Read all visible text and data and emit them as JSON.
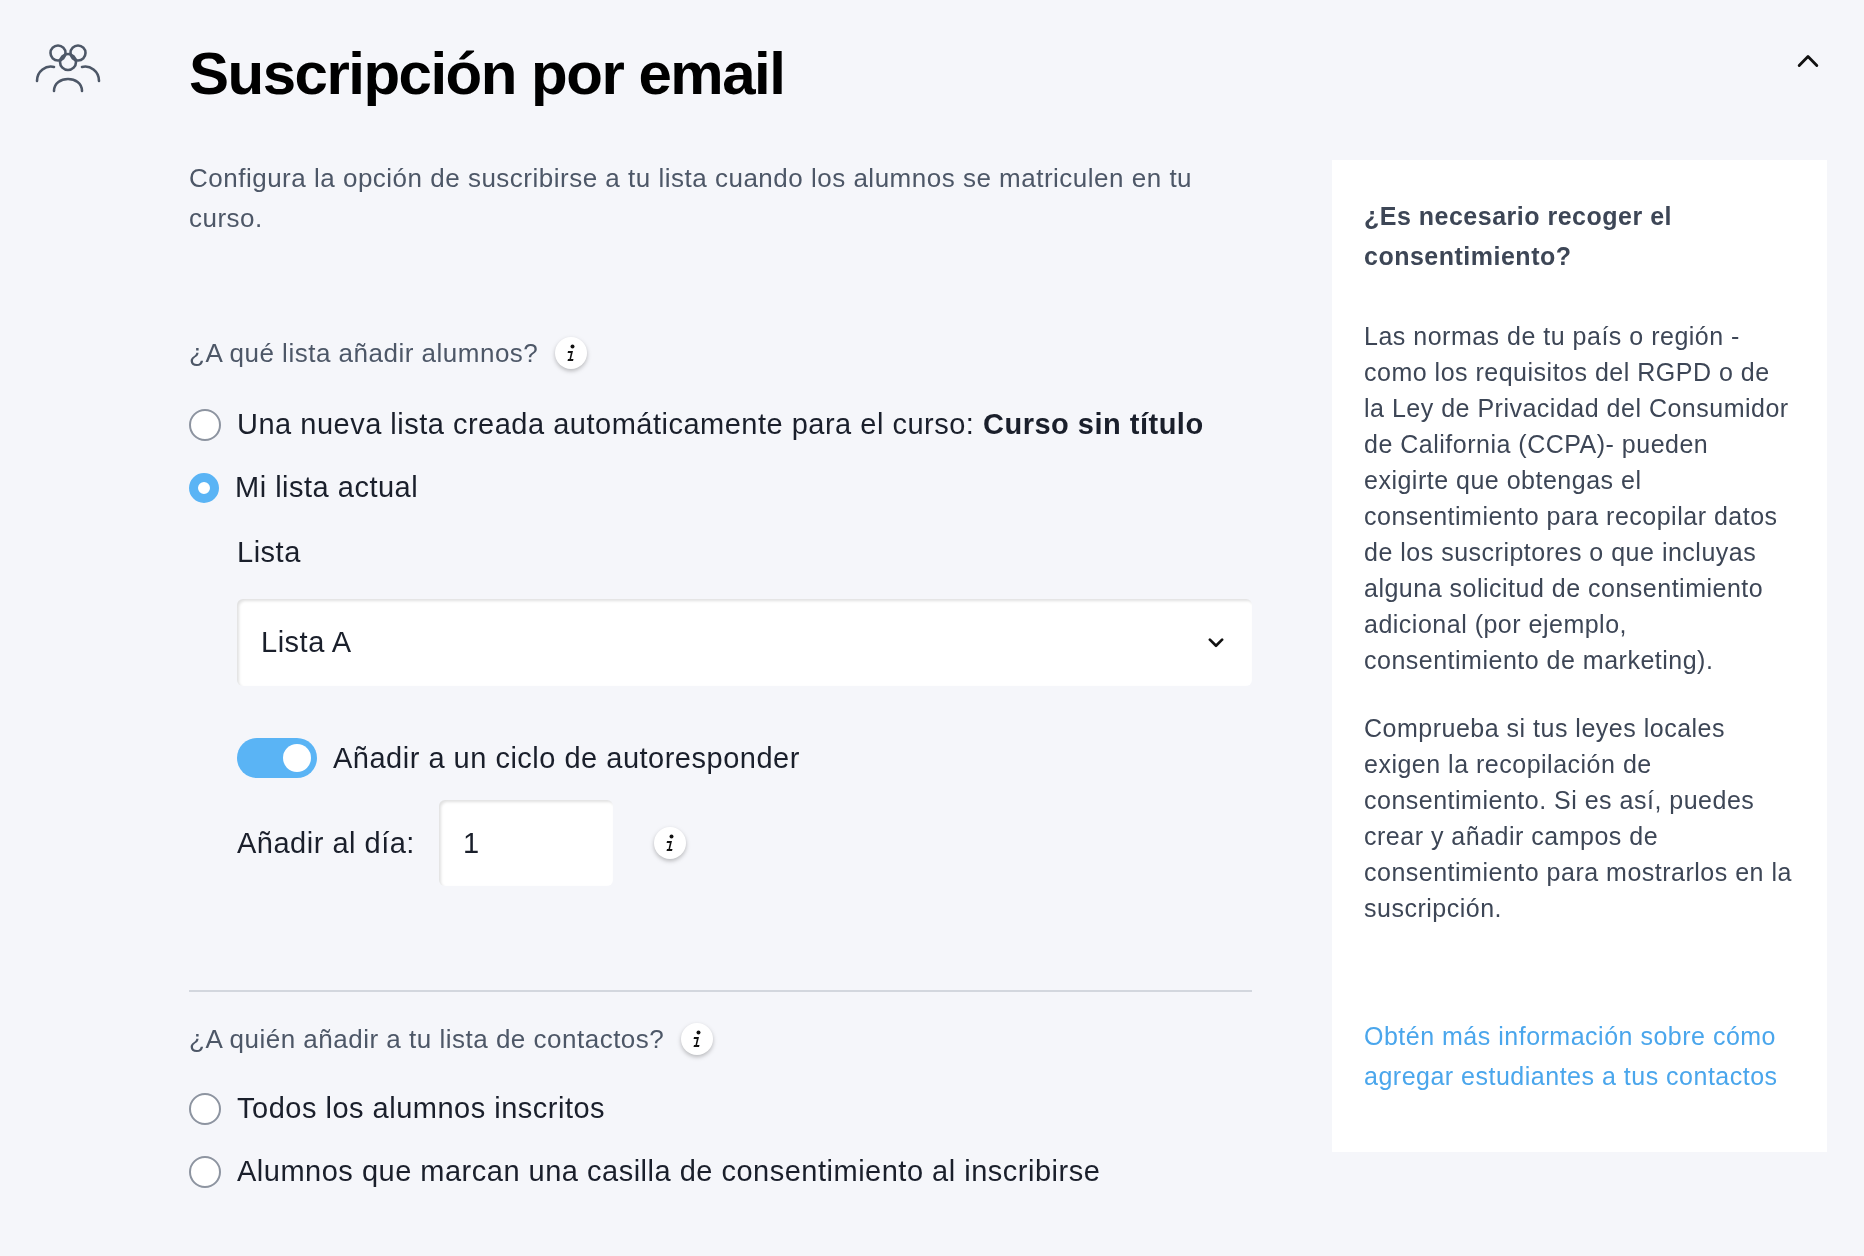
{
  "header": {
    "title": "Suscripción por email",
    "expanded": true
  },
  "description": "Configura la opción de suscribirse a tu lista cuando los alumnos se matriculen en tu curso.",
  "list_question": "¿A qué lista añadir alumnos?",
  "list_options": [
    {
      "label": "Una nueva lista creada automáticamente para el curso: **Curso sin título**",
      "selected": false
    },
    {
      "label": "Mi lista actual",
      "selected": true
    }
  ],
  "list_field": {
    "label": "Lista",
    "value": "Lista A"
  },
  "autoresponder": {
    "label": "Añadir a un ciclo de autoresponder",
    "on": true
  },
  "day_field": {
    "label": "Añadir al día:",
    "value": "1"
  },
  "contacts_question": "¿A quién añadir a tu lista de contactos?",
  "contacts_options": [
    {
      "label": "Todos los alumnos inscritos",
      "selected": false
    },
    {
      "label": "Alumnos que marcan una casilla de consentimiento al inscribirse",
      "selected": false
    }
  ],
  "help_panel": {
    "title": "¿Es necesario recoger el consentimiento?",
    "paragraphs": [
      "Las normas de tu país o región -como los requisitos del RGPD o de la Ley de Privacidad del Consumidor de California (CCPA)- pueden exigirte que obtengas el consentimiento para recopilar datos de los suscriptores o que incluyas alguna solicitud de consentimiento adicional (por ejemplo, consentimiento de marketing).",
      "Comprueba si tus leyes locales exigen la recopilación de consentimiento. Si es así, puedes crear y añadir campos de consentimiento para mostrarlos en la suscripción."
    ],
    "link": "Obtén más información sobre cómo agregar estudiantes a tus contactos"
  }
}
